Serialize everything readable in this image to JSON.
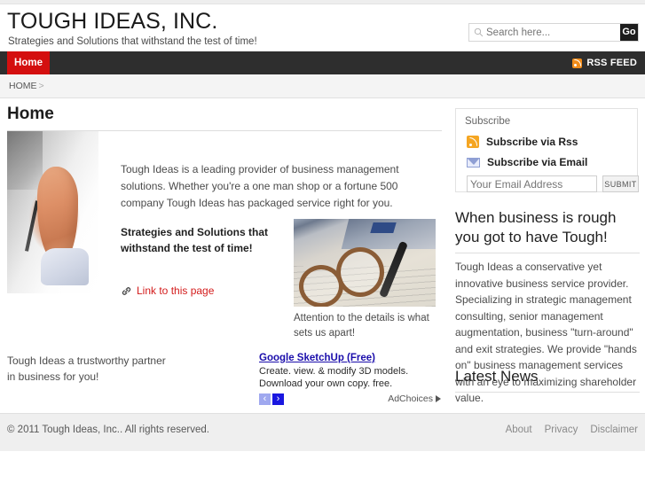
{
  "site": {
    "title": "TOUGH IDEAS, INC.",
    "tagline": "Strategies and Solutions that withstand the test of time!"
  },
  "search": {
    "placeholder": "Search here...",
    "value": "",
    "button_label": "Go",
    "icon": "search-icon"
  },
  "nav": {
    "items": [
      {
        "label": "Home",
        "active": true
      }
    ],
    "rss": {
      "label": "RSS FEED",
      "icon": "rss-icon"
    }
  },
  "breadcrumb": {
    "items": [
      "HOME"
    ],
    "separator": ">"
  },
  "main": {
    "page_title": "Home",
    "intro_paragraph": "Tough Ideas is a leading provider of business management solutions. Whether you're a one man shop or a fortune 500 company Tough Ideas has packaged service right for you.",
    "strategies_text": "Strategies and Solutions that withstand the test of time!",
    "link_to_page": {
      "label": "Link to this page",
      "icon": "link-icon",
      "color": "#d31b1b"
    },
    "detail_caption": "Attention to the details is what sets us apart!",
    "trustworthy_text": "Tough Ideas a trustworthy partner in business for you!",
    "hero_image_alt": "hand signing a document",
    "detail_image_alt": "eyeglasses and pen on a spreadsheet"
  },
  "ad": {
    "title": "Google SketchUp (Free)",
    "description": "Create. view. & modify 3D models. Download your own copy. free.",
    "prev_label": "‹",
    "next_label": "›",
    "adchoices_label": "AdChoices",
    "link_color": "#1a0dab"
  },
  "sidebar": {
    "subscribe": {
      "heading": "Subscribe",
      "rss_label": "Subscribe via Rss",
      "email_label": "Subscribe via Email",
      "email_placeholder": "Your Email Address",
      "email_value": "Your Email Address",
      "submit_label": "SUBMIT"
    },
    "promo": {
      "heading": "When business is rough you got to have Tough!",
      "body": "Tough Ideas a conservative yet innovative business service provider. Specializing in strategic management consulting, senior management augmentation, business \"turn-around\" and exit strategies. We provide \"hands on\" business management services with an eye to maximizing shareholder value."
    },
    "latest_news": {
      "heading": "Latest News"
    }
  },
  "footer": {
    "copyright": "© 2011 Tough Ideas, Inc.. All rights reserved.",
    "links": [
      {
        "label": "About"
      },
      {
        "label": "Privacy"
      },
      {
        "label": "Disclaimer"
      }
    ]
  },
  "theme": {
    "accent_red": "#d40f0f",
    "nav_dark": "#2e2e2e",
    "rss_orange": "#f5a623",
    "link_blue": "#1a0dab"
  }
}
